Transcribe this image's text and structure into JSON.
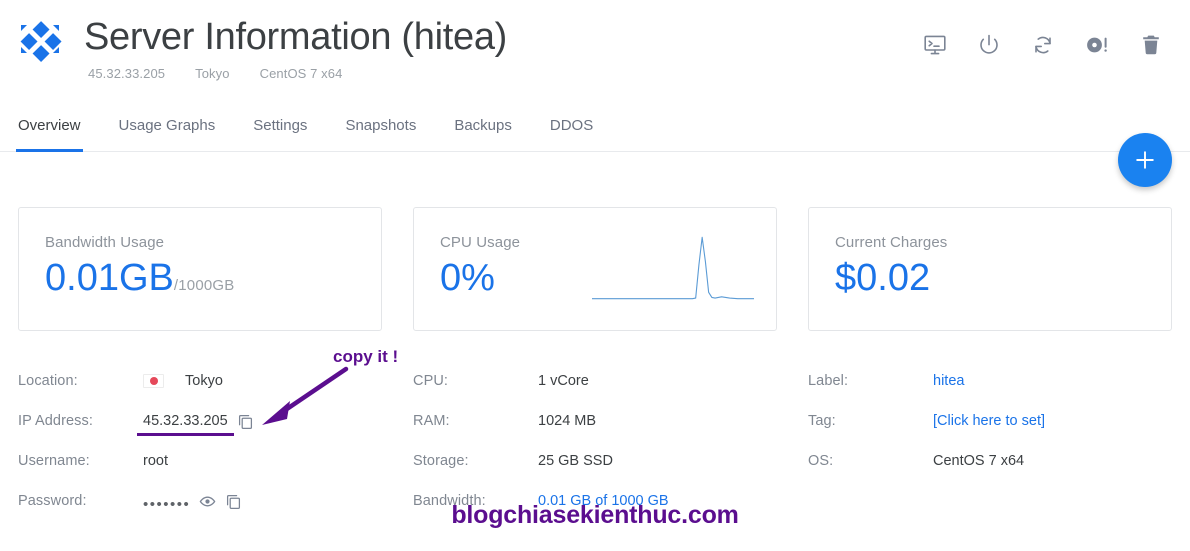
{
  "header": {
    "logo_name": "vultr-diamond-logo",
    "title": "Server Information (hitea)",
    "meta": [
      {
        "name": "ip",
        "text": "45.32.33.205"
      },
      {
        "name": "region",
        "text": "Tokyo"
      },
      {
        "name": "os",
        "text": "CentOS 7 x64"
      }
    ],
    "actions": [
      {
        "name": "console-icon",
        "title": "View Console"
      },
      {
        "name": "power-icon",
        "title": "Server Stop / Start"
      },
      {
        "name": "restart-icon",
        "title": "Server Restart"
      },
      {
        "name": "iso-icon",
        "title": "Mount ISO"
      },
      {
        "name": "trash-icon",
        "title": "Server Destroy"
      }
    ]
  },
  "tabs": [
    {
      "label": "Overview",
      "active": true
    },
    {
      "label": "Usage Graphs",
      "active": false
    },
    {
      "label": "Settings",
      "active": false
    },
    {
      "label": "Snapshots",
      "active": false
    },
    {
      "label": "Backups",
      "active": false
    },
    {
      "label": "DDOS",
      "active": false
    }
  ],
  "fab": {
    "label": "+",
    "name": "add-server-button"
  },
  "cards": [
    {
      "name": "bandwidth-usage-card",
      "label": "Bandwidth Usage",
      "value": "0.01GB",
      "suffix": "/1000GB",
      "has_chart": false
    },
    {
      "name": "cpu-usage-card",
      "label": "CPU Usage",
      "value": "0%",
      "suffix": "",
      "has_chart": true
    },
    {
      "name": "current-charges-card",
      "label": "Current Charges",
      "value": "$0.02",
      "suffix": "",
      "has_chart": false
    }
  ],
  "chart_data": {
    "type": "line",
    "title": "CPU Usage",
    "xlabel": "",
    "ylabel": "",
    "ylim": [
      0,
      100
    ],
    "grid": false,
    "legend": "none",
    "line_color": "#5b9bd5",
    "x": [
      0,
      5,
      10,
      15,
      20,
      25,
      30,
      35,
      40,
      45,
      50,
      55,
      60,
      62,
      64,
      66,
      68,
      70,
      72,
      74,
      76,
      80,
      85,
      90,
      95,
      100
    ],
    "y": [
      2,
      2,
      2,
      2,
      2,
      2,
      2,
      2,
      2,
      2,
      2,
      2,
      2,
      2,
      3,
      55,
      98,
      60,
      12,
      4,
      3,
      5,
      3,
      2,
      2,
      2
    ]
  },
  "details": {
    "col1": [
      {
        "name": "location",
        "label": "Location:",
        "value": "Tokyo",
        "type": "flag",
        "flag": "jp-flag-icon"
      },
      {
        "name": "ip-address",
        "label": "IP Address:",
        "value": "45.32.33.205",
        "type": "copyable",
        "underlined": true
      },
      {
        "name": "username",
        "label": "Username:",
        "value": "root",
        "type": "text"
      },
      {
        "name": "password",
        "label": "Password:",
        "value": "•••••••",
        "type": "password"
      }
    ],
    "col2": [
      {
        "name": "cpu",
        "label": "CPU:",
        "value": "1 vCore",
        "type": "text"
      },
      {
        "name": "ram",
        "label": "RAM:",
        "value": "1024 MB",
        "type": "text"
      },
      {
        "name": "storage",
        "label": "Storage:",
        "value": "25 GB SSD",
        "type": "text"
      },
      {
        "name": "bandwidth",
        "label": "Bandwidth:",
        "value": "0.01 GB of 1000 GB",
        "type": "link"
      }
    ],
    "col3": [
      {
        "name": "server-label",
        "label": "Label:",
        "value": "hitea",
        "type": "link"
      },
      {
        "name": "tag",
        "label": "Tag:",
        "value": "[Click here to set]",
        "type": "link"
      },
      {
        "name": "os",
        "label": "OS:",
        "value": "CentOS 7 x64",
        "type": "text"
      }
    ]
  },
  "annotations": {
    "callout_text": "copy it !",
    "callout_color": "#5b0e8f",
    "watermark": "blogchiasekienthuc.com"
  },
  "colors": {
    "accent_blue": "#1a73e8",
    "fab_blue": "#1a82f0",
    "annotation_purple": "#5b0e8f",
    "muted_gray": "#8d939b"
  }
}
